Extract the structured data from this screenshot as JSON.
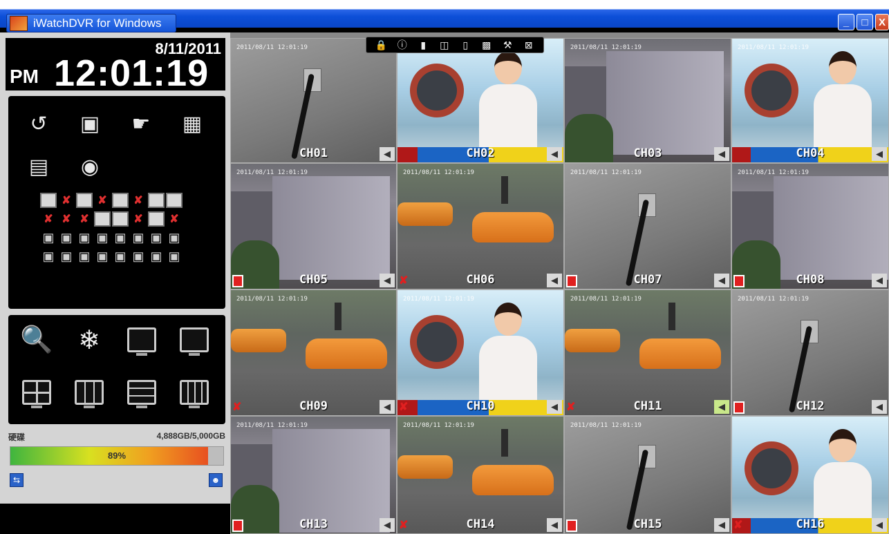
{
  "window": {
    "title": "iWatchDVR for Windows",
    "buttons": {
      "minimize": "_",
      "maximize": "□",
      "close": "X"
    }
  },
  "clock": {
    "date": "8/11/2011",
    "ampm": "PM",
    "time": "12:01:19"
  },
  "function_icons": [
    {
      "name": "playback-icon",
      "glyph": "↺"
    },
    {
      "name": "backup-icon",
      "glyph": "▣"
    },
    {
      "name": "ptz-remote-icon",
      "glyph": "☛"
    },
    {
      "name": "schedule-search-icon",
      "glyph": "▦"
    },
    {
      "name": "log-search-icon",
      "glyph": "▤"
    },
    {
      "name": "camera-icon",
      "glyph": "◉"
    }
  ],
  "channel_status": {
    "row1": [
      "mon",
      "dis",
      "mon",
      "dis",
      "mon",
      "dis",
      "mon",
      "mon"
    ],
    "row2": [
      "dis",
      "dis",
      "dis",
      "mon",
      "mon",
      "dis",
      "mon",
      "dis"
    ]
  },
  "view_icons": [
    {
      "name": "zoom-icon",
      "glyph": "🔍"
    },
    {
      "name": "freeze-icon",
      "glyph": "❄"
    },
    {
      "name": "pip-layout-icon"
    },
    {
      "name": "single-layout-icon"
    },
    {
      "name": "quad-layout-icon"
    },
    {
      "name": "nine-layout-icon"
    },
    {
      "name": "thirteen-layout-icon"
    },
    {
      "name": "sixteen-layout-icon"
    }
  ],
  "hdd": {
    "label_left": "硬碟",
    "label_right": "4,888GB/5,000GB",
    "percent_text": "89%",
    "fill_fraction": 0.928
  },
  "channels": [
    {
      "id": "CH01",
      "label": "CH01",
      "scene": "grey",
      "osd": "2011/08/11 12:01:19"
    },
    {
      "id": "CH02",
      "label": "CH02",
      "scene": "news",
      "osd": ""
    },
    {
      "id": "CH03",
      "label": "CH03",
      "scene": "street",
      "osd": "2011/08/11 12:01:19"
    },
    {
      "id": "CH04",
      "label": "CH04",
      "scene": "news",
      "osd": "2011/08/11 12:01:19"
    },
    {
      "id": "CH05",
      "label": "CH05",
      "scene": "street",
      "osd": "2011/08/11 12:01:19"
    },
    {
      "id": "CH06",
      "label": "CH06",
      "scene": "road",
      "osd": "2011/08/11 12:01:19"
    },
    {
      "id": "CH07",
      "label": "CH07",
      "scene": "grey",
      "osd": "2011/08/11 12:01:19"
    },
    {
      "id": "CH08",
      "label": "CH08",
      "scene": "street",
      "osd": "2011/08/11 12:01:19"
    },
    {
      "id": "CH09",
      "label": "CH09",
      "scene": "road",
      "osd": "2011/08/11 12:01:19"
    },
    {
      "id": "CH10",
      "label": "CH10",
      "scene": "news",
      "osd": "2011/08/11 12:01:19"
    },
    {
      "id": "CH11",
      "label": "CH11",
      "scene": "road",
      "osd": "2011/08/11 12:01:19"
    },
    {
      "id": "CH12",
      "label": "CH12",
      "scene": "grey",
      "osd": "2011/08/11 12:01:19"
    },
    {
      "id": "CH13",
      "label": "CH13",
      "scene": "street",
      "osd": "2011/08/11 12:01:19"
    },
    {
      "id": "CH14",
      "label": "CH14",
      "scene": "road",
      "osd": "2011/08/11 12:01:19"
    },
    {
      "id": "CH15",
      "label": "CH15",
      "scene": "grey",
      "osd": "2011/08/11 12:01:19"
    },
    {
      "id": "CH16",
      "label": "CH16",
      "scene": "news",
      "osd": ""
    }
  ],
  "toolbar": [
    {
      "name": "lock-icon",
      "glyph": "🔒"
    },
    {
      "name": "info-icon",
      "glyph": "ⓘ"
    },
    {
      "name": "video-icon",
      "glyph": "▮"
    },
    {
      "name": "snapshot-icon",
      "glyph": "◫"
    },
    {
      "name": "audio-icon",
      "glyph": "▯"
    },
    {
      "name": "settings-icon",
      "glyph": "▩"
    },
    {
      "name": "tools-icon",
      "glyph": "⚒"
    },
    {
      "name": "exit-icon",
      "glyph": "⊠"
    }
  ]
}
